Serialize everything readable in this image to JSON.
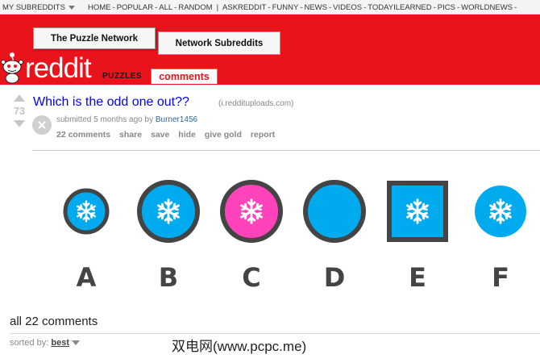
{
  "topbar": {
    "my_subreddits": "MY SUBREDDITS",
    "links": [
      "HOME",
      "POPULAR",
      "ALL",
      "RANDOM"
    ],
    "subs": [
      "ASKREDDIT",
      "FUNNY",
      "NEWS",
      "VIDEOS",
      "TODAYILEARNED",
      "PICS",
      "WORLDNEWS"
    ]
  },
  "header": {
    "puzzle_network": "The Puzzle Network",
    "network_subreddits": "Network Subreddits",
    "logo": "reddit",
    "subreddit": "PUZZLES",
    "active_tab": "comments"
  },
  "post": {
    "score": "73",
    "title": "Which is the odd one out??",
    "domain": "(i.reddituploads.com)",
    "submitted": "submitted 5 months ago by",
    "author": "Burner1456",
    "actions": [
      "22 comments",
      "share",
      "save",
      "hide",
      "give gold",
      "report"
    ],
    "options": [
      {
        "label": "A",
        "shape": "circle-small",
        "fill": "#00aaee",
        "border": "#444444",
        "icon": "snowflake-icon"
      },
      {
        "label": "B",
        "shape": "circle-large",
        "fill": "#00aaee",
        "border": "#444444",
        "icon": "snowflake-icon"
      },
      {
        "label": "C",
        "shape": "circle-large",
        "fill": "#ff44bb",
        "border": "#444444",
        "icon": "snowflake-icon"
      },
      {
        "label": "D",
        "shape": "circle-large",
        "fill": "#00aaee",
        "border": "#444444",
        "icon": "none"
      },
      {
        "label": "E",
        "shape": "square",
        "fill": "#00aaee",
        "border": "#444444",
        "icon": "snowflake-icon"
      },
      {
        "label": "F",
        "shape": "circle-noborder",
        "fill": "#00aaee",
        "border": "none",
        "icon": "snowflake-icon"
      }
    ]
  },
  "comments": {
    "heading": "all 22 comments",
    "sorted_by": "sorted by:",
    "sort_value": "best"
  },
  "watermark": "双电网(www.pcpc.me)",
  "colors": {
    "header_red": "#e8131b",
    "link_blue": "#0000ff",
    "author_blue": "#336699"
  }
}
